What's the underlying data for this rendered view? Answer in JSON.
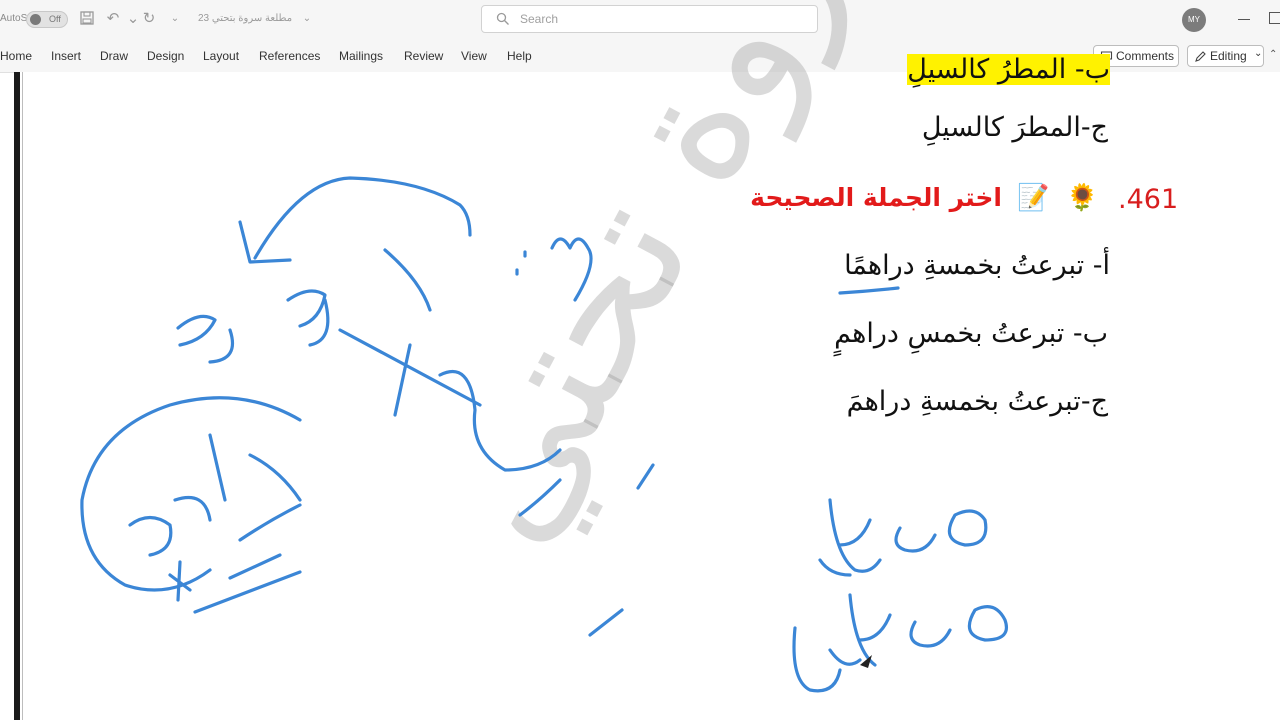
{
  "titlebar": {
    "autosave_label": "AutoSave",
    "autosave_state": "Off",
    "doc_title": "23 مطلعة سروة بتحتي",
    "search_placeholder": "Search",
    "avatar_initials": "MY",
    "accent": "#1e5bd8"
  },
  "ribbon": {
    "tabs": [
      "Home",
      "Insert",
      "Draw",
      "Design",
      "Layout",
      "References",
      "Mailings",
      "Review",
      "View",
      "Help"
    ],
    "comments_label": "Comments",
    "editing_label": "Editing"
  },
  "document": {
    "line_prev_b": "ب- المطرُ كالسيلِ",
    "line_prev_c": "ج-المطرَ كالسيلِ",
    "question_number": ".461",
    "question_title": "اختر الجملة الصحيحة",
    "option_a": "أ- تبرعتُ بخمسةِ دراهمًا",
    "option_b": "ب- تبرعتُ بخمسِ دراهمٍ",
    "option_c": "ج-تبرعتُ بخمسةِ دراهمَ",
    "emoji_flower": "🌻",
    "emoji_memo": "📝",
    "title_color": "#e21a1a",
    "ink_color": "#3b86d6"
  },
  "handwriting": {
    "mafaal": "مفاعل",
    "mafaeel": "مفاعيل",
    "dirham": "دراهم",
    "risala": "رسالة",
    "jeem": "ج",
    "seen": "س"
  },
  "watermark": {
    "text": "ثروة تحتي"
  }
}
